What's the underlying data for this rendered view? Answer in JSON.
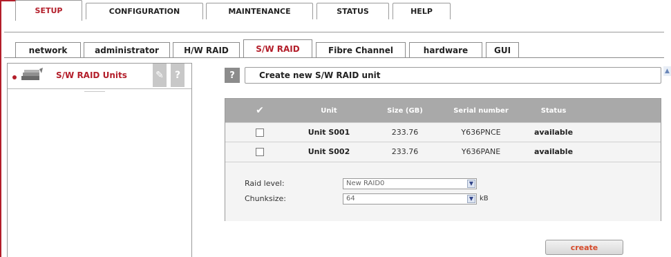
{
  "top_tabs": [
    {
      "label": "SETUP",
      "active": true
    },
    {
      "label": "CONFIGURATION",
      "active": false
    },
    {
      "label": "MAINTENANCE",
      "active": false
    },
    {
      "label": "STATUS",
      "active": false
    },
    {
      "label": "HELP",
      "active": false
    }
  ],
  "sub_tabs": [
    {
      "label": "network",
      "active": false
    },
    {
      "label": "administrator",
      "active": false
    },
    {
      "label": "H/W RAID",
      "active": false
    },
    {
      "label": "S/W RAID",
      "active": true
    },
    {
      "label": "Fibre Channel",
      "active": false
    },
    {
      "label": "hardware",
      "active": false
    },
    {
      "label": "GUI",
      "active": false
    }
  ],
  "left_panel": {
    "title": "S/W RAID Units",
    "tool_icon": "wrench-icon",
    "help_label": "?"
  },
  "main": {
    "help_label": "?",
    "header": "Create new S/W RAID unit",
    "table": {
      "columns": [
        "✔",
        "Unit",
        "Size (GB)",
        "Serial number",
        "Status"
      ],
      "rows": [
        {
          "unit": "Unit S001",
          "size": "233.76",
          "serial": "Y636PNCE",
          "status": "available",
          "checked": false
        },
        {
          "unit": "Unit S002",
          "size": "233.76",
          "serial": "Y636PANE",
          "status": "available",
          "checked": false
        }
      ]
    },
    "form": {
      "raid_level_label": "Raid level:",
      "raid_level_value": "New RAID0",
      "chunksize_label": "Chunksize:",
      "chunksize_value": "64",
      "chunksize_unit": "kB"
    },
    "create_label": "create"
  },
  "colors": {
    "accent": "#b31e2a",
    "table_header": "#a9a9a9",
    "create_text": "#d64a2a"
  }
}
